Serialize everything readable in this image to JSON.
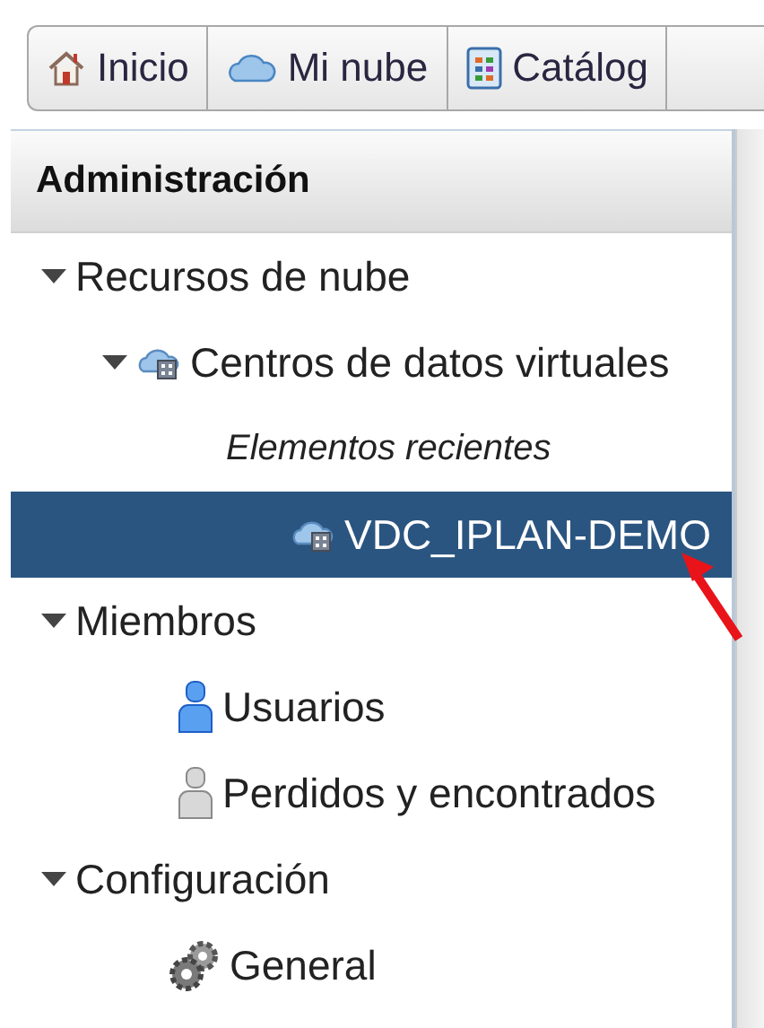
{
  "toolbar": {
    "tabs": [
      {
        "label": "Inicio",
        "kind": "home"
      },
      {
        "label": "Mi nube",
        "kind": "cloud"
      },
      {
        "label": "Catálog",
        "kind": "catalog"
      }
    ]
  },
  "sidebar": {
    "title": "Administración",
    "tree": [
      {
        "label": "Recursos de nube",
        "expanded": true,
        "selected": false,
        "children": [
          {
            "label": "Centros de datos virtuales",
            "kind": "vdc",
            "expanded": true,
            "selected": false,
            "children": [
              {
                "label": "Elementos recientes",
                "kind": "heading",
                "selected": false
              },
              {
                "label": "VDC_IPLAN-DEMO",
                "kind": "vdc",
                "selected": true
              }
            ]
          }
        ]
      },
      {
        "label": "Miembros",
        "expanded": true,
        "selected": false,
        "children": [
          {
            "label": "Usuarios",
            "kind": "user",
            "selected": false
          },
          {
            "label": "Perdidos y encontrados",
            "kind": "lost",
            "selected": false
          }
        ]
      },
      {
        "label": "Configuración",
        "expanded": true,
        "selected": false,
        "children": [
          {
            "label": "General",
            "kind": "settings",
            "selected": false
          }
        ]
      }
    ]
  }
}
